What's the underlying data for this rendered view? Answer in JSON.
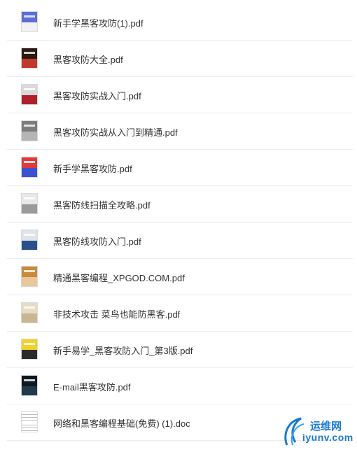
{
  "files": [
    {
      "name": "新手学黑客攻防(1).pdf",
      "thumb": "blue-cover-icon",
      "colors": [
        "#5b6fd6",
        "#f2f2f2"
      ]
    },
    {
      "name": "黑客攻防大全.pdf",
      "thumb": "dark-cover-icon",
      "colors": [
        "#2a1a14",
        "#c0392b"
      ]
    },
    {
      "name": "黑客攻防实战入门.pdf",
      "thumb": "red-cover-icon",
      "colors": [
        "#d9d9d9",
        "#b0202a"
      ]
    },
    {
      "name": "黑客攻防实战从入门到精通.pdf",
      "thumb": "grey-cover-icon",
      "colors": [
        "#7c7c7c",
        "#b5b5b5"
      ]
    },
    {
      "name": "新手学黑客攻防.pdf",
      "thumb": "colorful-cover-icon",
      "colors": [
        "#e03a3a",
        "#3b52d0"
      ]
    },
    {
      "name": "黑客防线扫描全攻略.pdf",
      "thumb": "light-cover-icon",
      "colors": [
        "#e8e8e8",
        "#9a9a9a"
      ]
    },
    {
      "name": "黑客防线攻防入门.pdf",
      "thumb": "blue-grey-cover-icon",
      "colors": [
        "#dfe3ea",
        "#2a4f8a"
      ]
    },
    {
      "name": "精通黑客编程_XPGOD.COM.pdf",
      "thumb": "orange-cover-icon",
      "colors": [
        "#c98a3a",
        "#e9c79a"
      ]
    },
    {
      "name": "非技术攻击 菜鸟也能防黑客.pdf",
      "thumb": "beige-cover-icon",
      "colors": [
        "#e7dcc3",
        "#c9b793"
      ]
    },
    {
      "name": "新手易学_黑客攻防入门_第3版.pdf",
      "thumb": "yellow-cover-icon",
      "colors": [
        "#f1d22a",
        "#2b2b2b"
      ]
    },
    {
      "name": "E-mail黑客攻防.pdf",
      "thumb": "black-cover-icon",
      "colors": [
        "#101820",
        "#1f3a4a"
      ]
    },
    {
      "name": "网络和黑客编程基础(免费) (1).doc",
      "thumb": "document-icon",
      "colors": [
        "#ffffff",
        "#f4f4f4"
      ]
    }
  ],
  "watermark": {
    "line1": "运维网",
    "line2": "iyunv.com"
  }
}
